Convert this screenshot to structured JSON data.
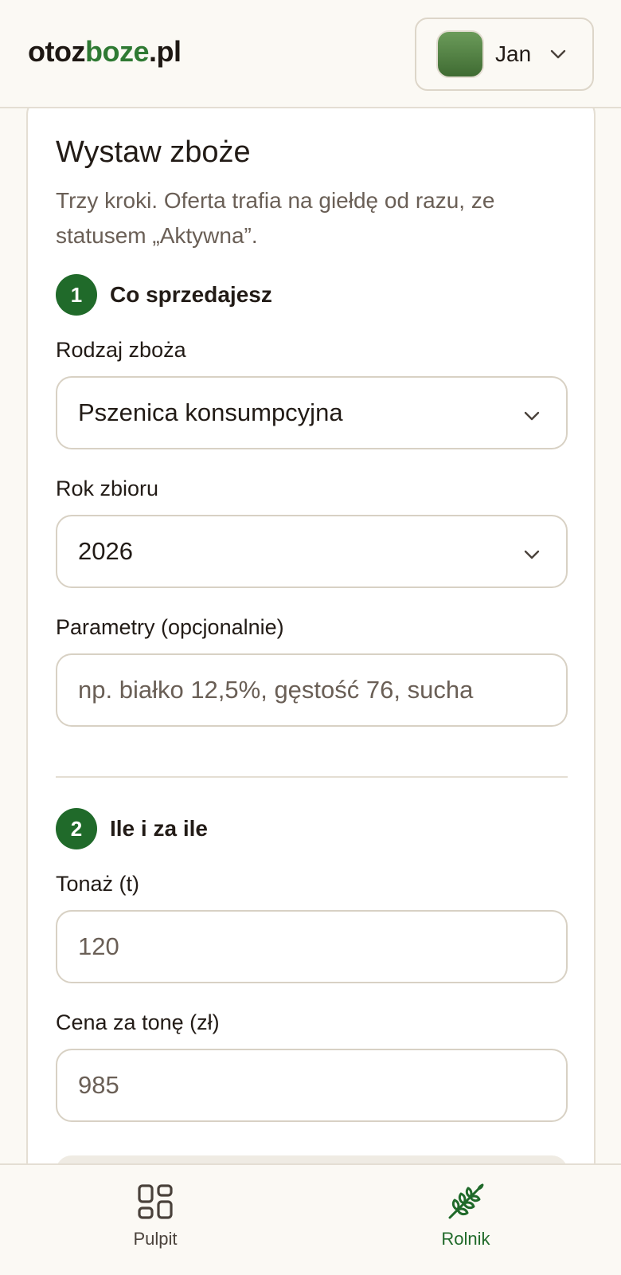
{
  "header": {
    "logo_part1": "otoz",
    "logo_part2": "boze",
    "logo_part3": ".pl",
    "user_name": "Jan"
  },
  "form": {
    "title": "Wystaw zboże",
    "subtitle": "Trzy kroki. Oferta trafia na giełdę od razu, ze statusem „Aktywna”.",
    "step1": {
      "number": "1",
      "label": "Co sprzedajesz",
      "grain_label": "Rodzaj zboża",
      "grain_value": "Pszenica konsumpcyjna",
      "year_label": "Rok zbioru",
      "year_value": "2026",
      "params_label": "Parametry (opcjonalnie)",
      "params_placeholder": "np. białko 12,5%, gęstość 76, sucha"
    },
    "step2": {
      "number": "2",
      "label": "Ile i za ile",
      "tonnage_label": "Tonaż (t)",
      "tonnage_value": "120",
      "price_label": "Cena za tonę (zł)",
      "price_value": "985"
    }
  },
  "nav": {
    "items": [
      {
        "label": "Pulpit",
        "icon": "grid-icon",
        "active": false
      },
      {
        "label": "Rolnik",
        "icon": "wheat-icon",
        "active": true
      }
    ]
  },
  "colors": {
    "accent": "#206a2a",
    "logo_green": "#2f7a33",
    "background": "#fbf9f4",
    "border": "#e4ded3"
  }
}
